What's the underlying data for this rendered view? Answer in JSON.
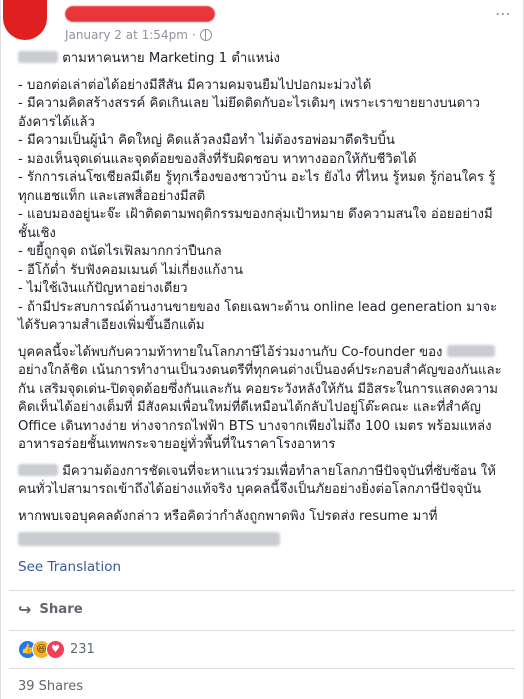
{
  "post": {
    "timestamp": "January 2 at 1:54pm",
    "intro": "ตามหาคนหาย Marketing 1 ตำแหน่ง",
    "bullets": [
      "- บอกต่อเล่าต่อได้อย่างมีสีสัน มีความคมจนยืมไปปอกมะม่วงได้",
      "- มีความคิดสร้างสรรค์ คิดเกินเลย ไม่ยึดติดกับอะไรเดิมๆ เพราะเราขายยางบนดาวอังคารได้แล้ว",
      "- มีความเป็นผู้นำ คิดใหญ่ คิดแล้วลงมือทำ ไม่ต้องรอพ่อมาตีดริบบิ้น",
      "- มองเห็นจุดเด่นและจุดด้อยของสิ่งที่รับผิดชอบ หาทางออกให้กับชีวิตได้",
      "- รักการเล่นโซเชียลมีเดีย รู้ทุกเรื่องของชาวบ้าน อะไร ยังไง ที่ไหน รู้หมด รู้ก่อนใคร รู้ทุกแฮชแท็ก และเสพสื่ออย่างมีสติ",
      "- แอบมองอยู่นะจ๊ะ เฝ้าติดตามพฤติกรรมของกลุ่มเป้าหมาย ดึงความสนใจ อ่อยอย่างมีชั้นเชิง",
      "- ขยี้ถูกจุด ถนัดไรเฟิลมากกว่าปืนกล",
      "- อีโก้ต่ำ รับฟังคอมเมนต์ ไม่เกี่ยงแก้งาน",
      "- ไม่ใช้เงินแก้ปัญหาอย่างเดียว",
      "- ถ้ามีประสบการณ์ด้านงานขายของ โดยเฉพาะด้าน online lead generation มาจะได้รับความสำเอียงเพิ่มขึ้นอีกแต้ม"
    ],
    "para1_a": "บุคคลนี้จะได้พบกับความท้าทายในโลกภาษีไอ้ร่วมงานกับ Co-founder ของ",
    "para1_b": "อย่างใกล้ชิด เน้นการทำงานเป็นวงดนตรีที่ทุกคนต่างเป็นองค์ประกอบสำคัญของกันและกัน เสริมจุดเด่น-ปิดจุดด้อยซึ่งกันและกัน คอยระวังหลังให้กัน มีอิสระในการแสดงความคิดเห็นได้อย่างเต็มที่ มีสังคมเพื่อนใหม่ที่ดีเหมือนได้กลับไปอยู่โต๊ะคณะ และที่สำคัญ Office เดินทางง่าย ห่างจากรถไฟฟ้า BTS บางจากเพียงไม่ถึง 100 เมตร พร้อมแหล่งอาหารอร่อยชั้นเทพกระจายอยู่ทั่วพื้นที่ในราคาโรงอาหาร",
    "para2": "มีความต้องการชัดเจนที่จะหาแนวร่วมเพื่อทำลายโลกภาษีปัจจุบันที่ซับซ้อน ให้คนทั่วไปสามารถเข้าถึงได้อย่างแท้จริง บุคคลนี้จึงเป็นภัยอย่างยิ่งต่อโลกภาษีปัจจุบัน",
    "para3": "หากพบเจอบุคคลดังกล่าว หรือคิดว่ากำลังถูกพาดพิง โปรดส่ง resume มาที่"
  },
  "actions": {
    "see_translation": "See Translation",
    "share_label": "Share"
  },
  "footer": {
    "reaction_count": "231",
    "shares_label": "39 Shares"
  },
  "colors": {
    "link": "#385898",
    "avatar": "#e02020"
  }
}
